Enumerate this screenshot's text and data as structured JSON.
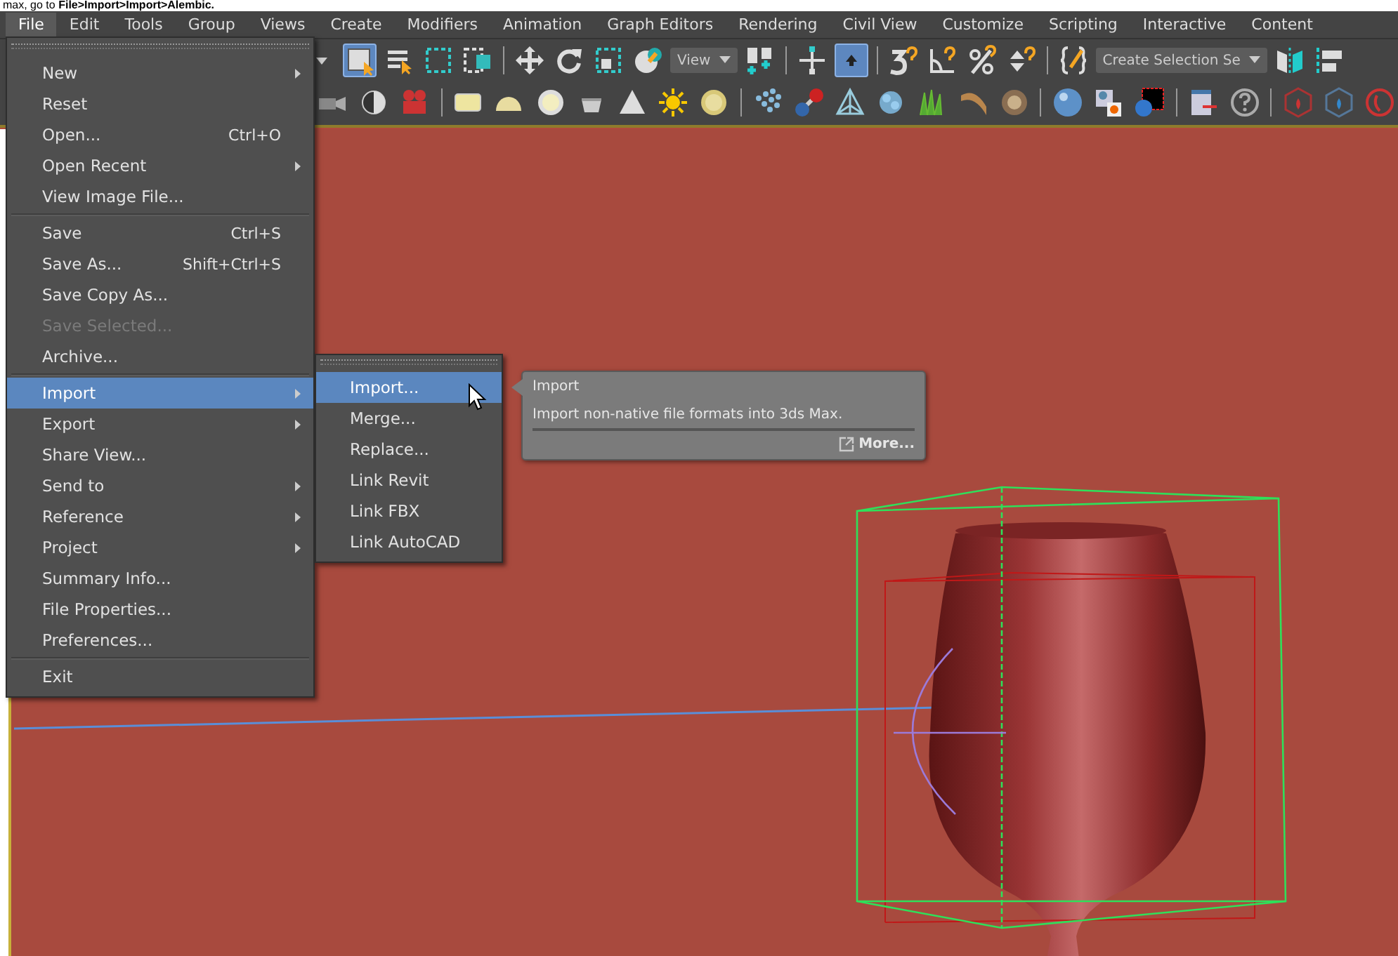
{
  "caption": "max, go to **File>Import>Import>Alembic.**",
  "menu_bar": [
    {
      "label": "File",
      "selected": true
    },
    {
      "label": "Edit",
      "selected": false
    },
    {
      "label": "Tools",
      "selected": false
    },
    {
      "label": "Group",
      "selected": false
    },
    {
      "label": "Views",
      "selected": false
    },
    {
      "label": "Create",
      "selected": false
    },
    {
      "label": "Modifiers",
      "selected": false
    },
    {
      "label": "Animation",
      "selected": false
    },
    {
      "label": "Graph Editors",
      "selected": false
    },
    {
      "label": "Rendering",
      "selected": false
    },
    {
      "label": "Civil View",
      "selected": false
    },
    {
      "label": "Customize",
      "selected": false
    },
    {
      "label": "Scripting",
      "selected": false
    },
    {
      "label": "Interactive",
      "selected": false
    },
    {
      "label": "Content",
      "selected": false
    }
  ],
  "main_toolbar": [
    {
      "kind": "button",
      "selected": true
    },
    {
      "kind": "button",
      "selected": false
    },
    {
      "kind": "button",
      "selected": false
    },
    {
      "kind": "button",
      "selected": false
    },
    {
      "kind": "button",
      "selected": false
    },
    {
      "kind": "button",
      "selected": false
    },
    {
      "kind": "button",
      "selected": false
    },
    {
      "kind": "button",
      "selected": false
    },
    {
      "kind": "dropdown",
      "value": "View"
    },
    {
      "kind": "button",
      "selected": false
    },
    {
      "kind": "button",
      "selected": false
    },
    {
      "kind": "button",
      "selected": true
    },
    {
      "kind": "button",
      "selected": false
    },
    {
      "kind": "button",
      "selected": false
    },
    {
      "kind": "button",
      "selected": false
    },
    {
      "kind": "button",
      "selected": false
    },
    {
      "kind": "button",
      "selected": false
    },
    {
      "kind": "dropdown",
      "value": "Create Selection Se"
    },
    {
      "kind": "button",
      "selected": false
    },
    {
      "kind": "button",
      "selected": false
    }
  ],
  "file_menu": [
    {
      "kind": "item",
      "label": "New",
      "submenu": true,
      "disabled": false,
      "selected": false
    },
    {
      "kind": "item",
      "label": "Reset",
      "submenu": false,
      "disabled": false,
      "selected": false
    },
    {
      "kind": "item",
      "label": "Open...",
      "shortcut": "Ctrl+O",
      "submenu": false,
      "disabled": false,
      "selected": false
    },
    {
      "kind": "item",
      "label": "Open Recent",
      "submenu": true,
      "disabled": false,
      "selected": false
    },
    {
      "kind": "item",
      "label": "View Image File...",
      "submenu": false,
      "disabled": false,
      "selected": false
    },
    {
      "kind": "separator"
    },
    {
      "kind": "item",
      "label": "Save",
      "shortcut": "Ctrl+S",
      "submenu": false,
      "disabled": false,
      "selected": false
    },
    {
      "kind": "item",
      "label": "Save As...",
      "shortcut": "Shift+Ctrl+S",
      "submenu": false,
      "disabled": false,
      "selected": false
    },
    {
      "kind": "item",
      "label": "Save Copy As...",
      "submenu": false,
      "disabled": false,
      "selected": false
    },
    {
      "kind": "item",
      "label": "Save Selected...",
      "submenu": false,
      "disabled": true,
      "selected": false
    },
    {
      "kind": "item",
      "label": "Archive...",
      "submenu": false,
      "disabled": false,
      "selected": false
    },
    {
      "kind": "separator"
    },
    {
      "kind": "item",
      "label": "Import",
      "submenu": true,
      "disabled": false,
      "selected": true
    },
    {
      "kind": "item",
      "label": "Export",
      "submenu": true,
      "disabled": false,
      "selected": false
    },
    {
      "kind": "item",
      "label": "Share View...",
      "submenu": false,
      "disabled": false,
      "selected": false
    },
    {
      "kind": "item",
      "label": "Send to",
      "submenu": true,
      "disabled": false,
      "selected": false
    },
    {
      "kind": "item",
      "label": "Reference",
      "submenu": true,
      "disabled": false,
      "selected": false
    },
    {
      "kind": "item",
      "label": "Project",
      "submenu": true,
      "disabled": false,
      "selected": false
    },
    {
      "kind": "item",
      "label": "Summary Info...",
      "submenu": false,
      "disabled": false,
      "selected": false
    },
    {
      "kind": "item",
      "label": "File Properties...",
      "submenu": false,
      "disabled": false,
      "selected": false
    },
    {
      "kind": "item",
      "label": "Preferences...",
      "submenu": false,
      "disabled": false,
      "selected": false
    },
    {
      "kind": "separator"
    },
    {
      "kind": "item",
      "label": "Exit",
      "submenu": false,
      "disabled": false,
      "selected": false
    }
  ],
  "import_submenu": [
    {
      "label": "Import...",
      "selected": true
    },
    {
      "label": "Merge...",
      "selected": false
    },
    {
      "label": "Replace...",
      "selected": false
    },
    {
      "label": "Link Revit",
      "selected": false
    },
    {
      "label": "Link FBX",
      "selected": false
    },
    {
      "label": "Link AutoCAD",
      "selected": false
    }
  ],
  "tooltip": {
    "title": "Import",
    "description": "Import non-native file formats into 3ds Max.",
    "link": "More..."
  }
}
